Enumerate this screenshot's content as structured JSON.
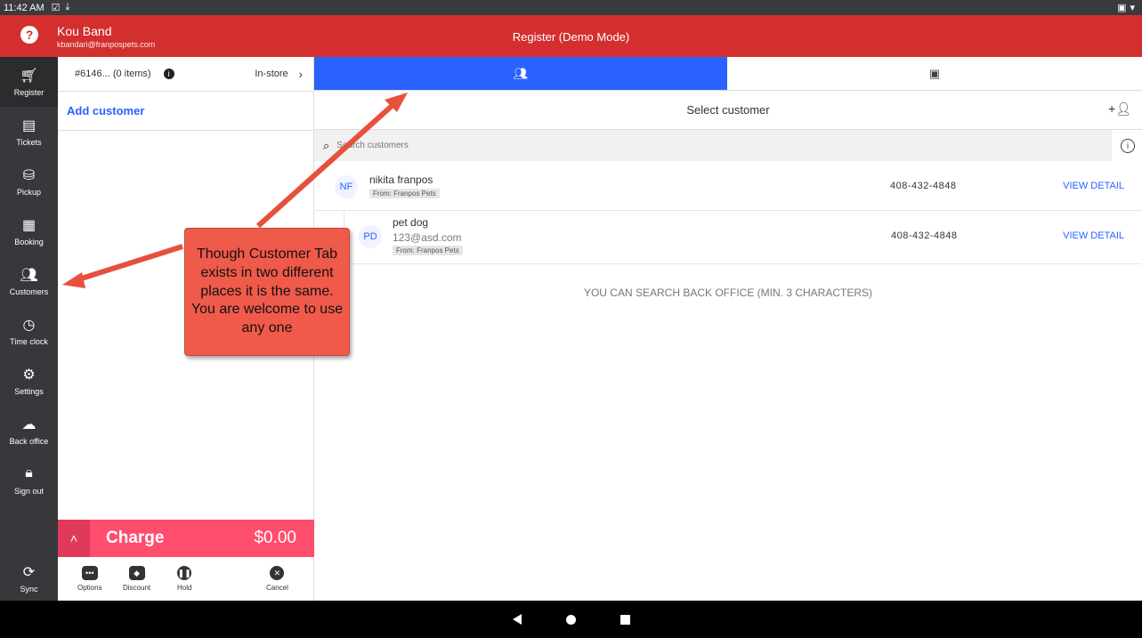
{
  "status_bar": {
    "time": "11:42 AM"
  },
  "header": {
    "user_name": "Kou Band",
    "user_email": "kbandari@franpospets.com",
    "title": "Register  (Demo Mode)"
  },
  "sidenav": [
    {
      "label": "Register",
      "icon": "cart-icon"
    },
    {
      "label": "Tickets",
      "icon": "tickets-icon"
    },
    {
      "label": "Pickup",
      "icon": "pickup-icon"
    },
    {
      "label": "Booking",
      "icon": "calendar-icon"
    },
    {
      "label": "Customers",
      "icon": "people-icon"
    },
    {
      "label": "Time clock",
      "icon": "clock-icon"
    },
    {
      "label": "Settings",
      "icon": "gear-icon"
    },
    {
      "label": "Back office",
      "icon": "cloud-icon"
    },
    {
      "label": "Sign out",
      "icon": "lock-icon"
    },
    {
      "label": "Sync",
      "icon": "sync-icon"
    }
  ],
  "cart": {
    "order": "#6146... (0 items)",
    "mode": "In-store",
    "add_customer": "Add customer",
    "charge_label": "Charge",
    "charge_amount": "$0.00",
    "actions": [
      "Options",
      "Discount",
      "Hold",
      "Cancel"
    ]
  },
  "main": {
    "select_title": "Select customer",
    "search_placeholder": "Search customers",
    "customers": [
      {
        "initials": "NF",
        "name": "nikita franpos",
        "email": "",
        "source": "From: Franpos Pets",
        "phone": "408-432-4848",
        "action": "VIEW DETAIL"
      },
      {
        "initials": "PD",
        "name": "pet dog",
        "email": "123@asd.com",
        "source": "From: Franpos Pets",
        "phone": "408-432-4848",
        "action": "VIEW DETAIL"
      }
    ],
    "hint": "YOU CAN SEARCH BACK OFFICE (MIN. 3 CHARACTERS)"
  },
  "callout": {
    "text": "Though Customer Tab exists in two different places it is the same. You are welcome to use any one",
    "color": "#f05a4a"
  },
  "colors": {
    "header": "#d32f2f",
    "accent": "#2962ff",
    "charge": "#ff4d6d"
  }
}
